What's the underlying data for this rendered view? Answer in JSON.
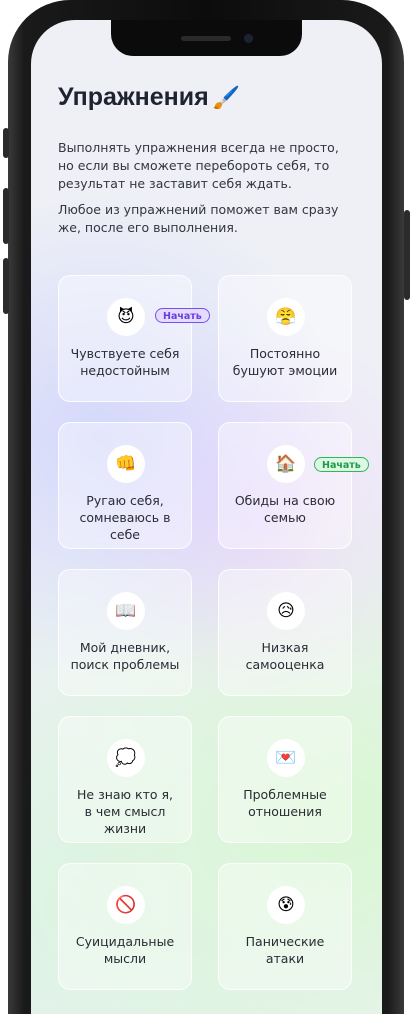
{
  "header": {
    "title": "Упражнения",
    "title_emoji": "🖌️"
  },
  "intro": {
    "paragraph_1": "Выполнять упражнения всегда не просто, но если вы сможете перебороть себя, то результат не заставит себя ждать.",
    "paragraph_2": "Любое из упражнений поможет вам сразу же, после его выполнения."
  },
  "cards": [
    {
      "emoji": "😈",
      "line1": "Чувствуете себя",
      "line2": "недостойным",
      "badge": "Начать"
    },
    {
      "emoji": "😤",
      "line1": "Постоянно",
      "line2": "бушуют эмоции",
      "badge": ""
    },
    {
      "emoji": "👊",
      "line1": "Ругаю себя,",
      "line2": "сомневаюсь в себе",
      "badge": ""
    },
    {
      "emoji": "🏠",
      "line1": "Обиды на свою",
      "line2": "семью",
      "badge": "Начать"
    },
    {
      "emoji": "📖",
      "line1": "Мой дневник,",
      "line2": "поиск проблемы",
      "badge": ""
    },
    {
      "emoji": "😥",
      "line1": "Низкая",
      "line2": "самооценка",
      "badge": ""
    },
    {
      "emoji": "💭",
      "line1": "Не знаю кто я,",
      "line2": "в чем смысл жизни",
      "badge": ""
    },
    {
      "emoji": "💌",
      "line1": "Проблемные",
      "line2": "отношения",
      "badge": ""
    },
    {
      "emoji": "🚫",
      "line1": "Суицидальные",
      "line2": "мысли",
      "badge": ""
    },
    {
      "emoji": "😰",
      "line1": "Панические",
      "line2": "атаки",
      "badge": ""
    }
  ],
  "colors": {
    "badge_purple": "#7a4ff0",
    "badge_green": "#2fb75a",
    "text_dark": "#1f2230"
  }
}
